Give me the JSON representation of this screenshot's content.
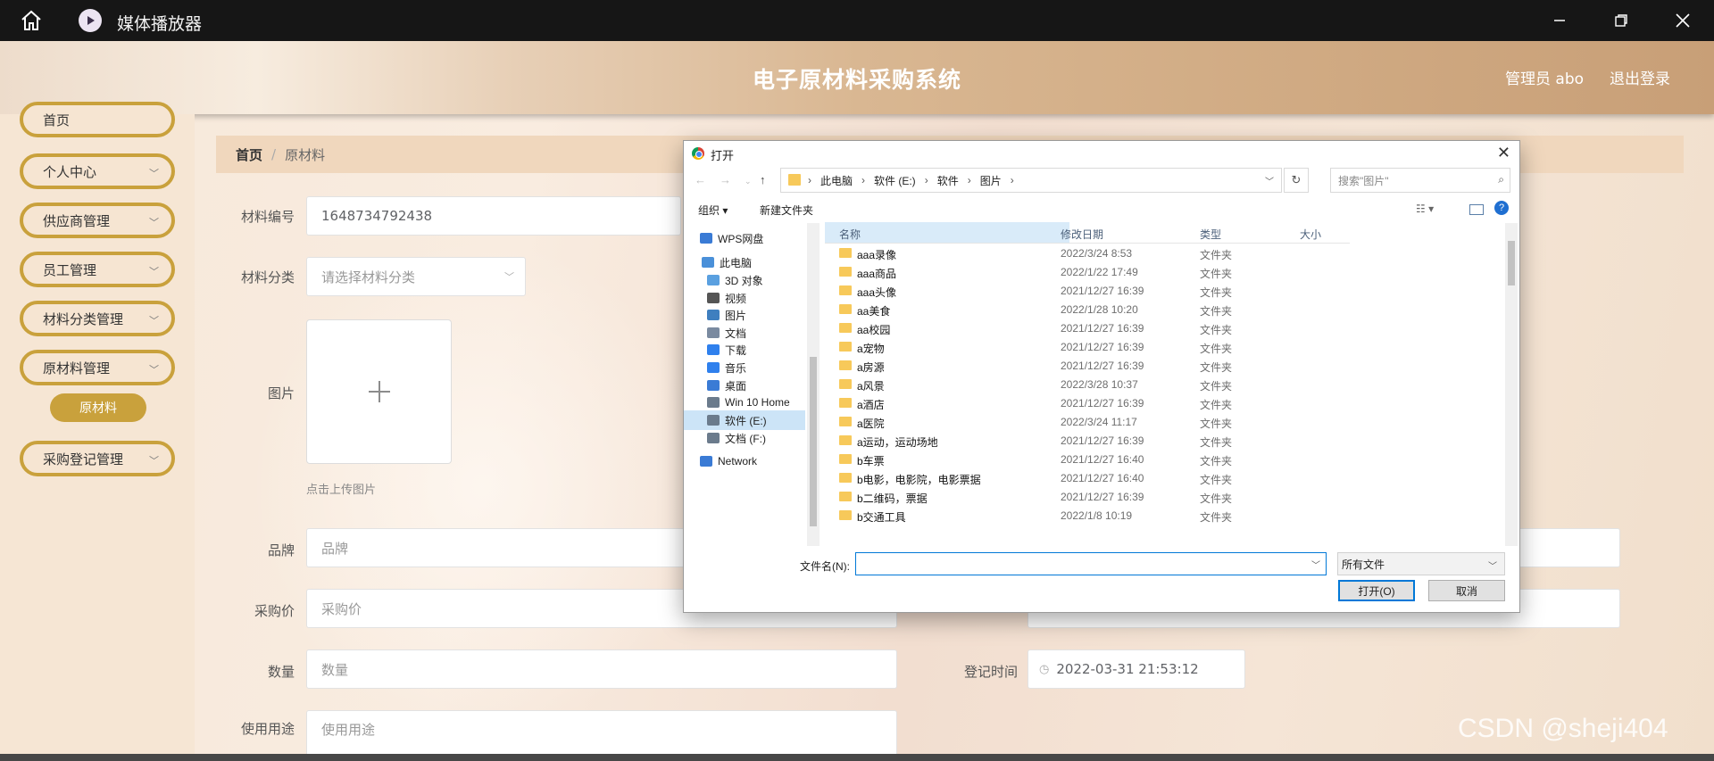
{
  "player": {
    "title": "媒体播放器",
    "icons": {
      "home": "home-icon",
      "logo": "play-icon",
      "min": "minimize-icon",
      "max": "restore-icon",
      "close": "close-icon"
    }
  },
  "header": {
    "title": "电子原材料采购系统",
    "user": "管理员 abo",
    "logout": "退出登录"
  },
  "sidebar": {
    "items": [
      {
        "label": "首页"
      },
      {
        "label": "个人中心"
      },
      {
        "label": "供应商管理"
      },
      {
        "label": "员工管理"
      },
      {
        "label": "材料分类管理"
      },
      {
        "label": "原材料管理"
      },
      {
        "label": "采购登记管理"
      }
    ],
    "sub_active": "原材料"
  },
  "breadcrumb": {
    "home": "首页",
    "sep": "/",
    "current": "原材料"
  },
  "form": {
    "code_label": "材料编号",
    "code_value": "1648734792438",
    "category_label": "材料分类",
    "category_placeholder": "请选择材料分类",
    "image_label": "图片",
    "upload_hint": "点击上传图片",
    "brand_label": "品牌",
    "brand_placeholder": "品牌",
    "purchase_label": "采购价",
    "purchase_placeholder": "采购价",
    "qty_label": "数量",
    "qty_placeholder": "数量",
    "date_label": "登记时间",
    "date_value": "2022-03-31 21:53:12",
    "usage_label": "使用用途",
    "usage_placeholder": "使用用途"
  },
  "dialog": {
    "title": "打开",
    "path": [
      "此电脑",
      "软件 (E:)",
      "软件",
      "图片"
    ],
    "search_placeholder": "搜索\"图片\"",
    "organize": "组织 ▾",
    "new_folder": "新建文件夹",
    "tree": [
      {
        "label": "WPS网盘",
        "color": "#3a7bd5"
      },
      {
        "label": "此电脑",
        "color": "#4a90d9"
      },
      {
        "label": "3D 对象",
        "color": "#5aa0e0"
      },
      {
        "label": "视频",
        "color": "#555555"
      },
      {
        "label": "图片",
        "color": "#3f7fbf"
      },
      {
        "label": "文档",
        "color": "#7a8aa0"
      },
      {
        "label": "下载",
        "color": "#2f80ed"
      },
      {
        "label": "音乐",
        "color": "#2f80ed"
      },
      {
        "label": "桌面",
        "color": "#3a7bd5"
      },
      {
        "label": "Win 10 Home",
        "color": "#6b7b8c"
      },
      {
        "label": "软件 (E:)",
        "color": "#6b7b8c",
        "selected": true
      },
      {
        "label": "文档 (F:)",
        "color": "#6b7b8c"
      },
      {
        "label": "Network",
        "color": "#3a7bd5"
      }
    ],
    "columns": {
      "name": "名称",
      "date": "修改日期",
      "type": "类型",
      "size": "大小"
    },
    "rows": [
      {
        "name": "aaa录像",
        "date": "2022/3/24 8:53",
        "type": "文件夹"
      },
      {
        "name": "aaa商品",
        "date": "2022/1/22 17:49",
        "type": "文件夹"
      },
      {
        "name": "aaa头像",
        "date": "2021/12/27 16:39",
        "type": "文件夹"
      },
      {
        "name": "aa美食",
        "date": "2022/1/28 10:20",
        "type": "文件夹"
      },
      {
        "name": "aa校园",
        "date": "2021/12/27 16:39",
        "type": "文件夹"
      },
      {
        "name": "a宠物",
        "date": "2021/12/27 16:39",
        "type": "文件夹"
      },
      {
        "name": "a房源",
        "date": "2021/12/27 16:39",
        "type": "文件夹"
      },
      {
        "name": "a风景",
        "date": "2022/3/28 10:37",
        "type": "文件夹"
      },
      {
        "name": "a酒店",
        "date": "2021/12/27 16:39",
        "type": "文件夹"
      },
      {
        "name": "a医院",
        "date": "2022/3/24 11:17",
        "type": "文件夹"
      },
      {
        "name": "a运动，运动场地",
        "date": "2021/12/27 16:39",
        "type": "文件夹"
      },
      {
        "name": "b车票",
        "date": "2021/12/27 16:40",
        "type": "文件夹"
      },
      {
        "name": "b电影，电影院，电影票据",
        "date": "2021/12/27 16:40",
        "type": "文件夹"
      },
      {
        "name": "b二维码，票据",
        "date": "2021/12/27 16:39",
        "type": "文件夹"
      },
      {
        "name": "b交通工具",
        "date": "2022/1/8 10:19",
        "type": "文件夹"
      }
    ],
    "filename_label": "文件名(N):",
    "filename_value": "",
    "filetype": "所有文件",
    "open_btn": "打开(O)",
    "cancel_btn": "取消"
  },
  "watermark": "CSDN @sheji404"
}
